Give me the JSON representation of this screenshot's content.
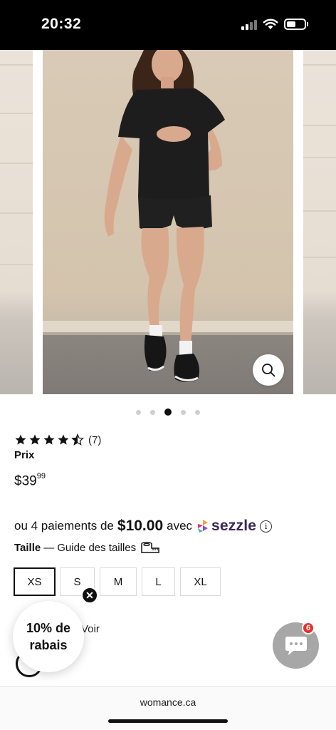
{
  "status_bar": {
    "time": "20:32"
  },
  "gallery": {
    "dot_count": 5,
    "active_dot": 2
  },
  "product": {
    "rating_stars": 4.5,
    "rating_count": "(7)",
    "price_label": "Prix",
    "price_dollars": "$39",
    "price_cents": "99"
  },
  "sezzle": {
    "prefix": "ou 4 paiements de",
    "amount": "$10.00",
    "suffix": "avec",
    "brand": "sezzle",
    "info": "i"
  },
  "size": {
    "label": "Taille",
    "dash": "—",
    "guide": "Guide des tailles",
    "options": [
      "XS",
      "S",
      "M",
      "L",
      "XL"
    ],
    "selected": "XS"
  },
  "promo": {
    "line1": "10% de",
    "line2": "rabais",
    "close": "✕",
    "partial_text": "Voir"
  },
  "chat": {
    "badge": "6"
  },
  "browser": {
    "url": "womance.ca"
  },
  "colors": {
    "brand_sezzle": "#382757",
    "badge": "#e5312d",
    "chat_bg": "#a7a7a7"
  }
}
